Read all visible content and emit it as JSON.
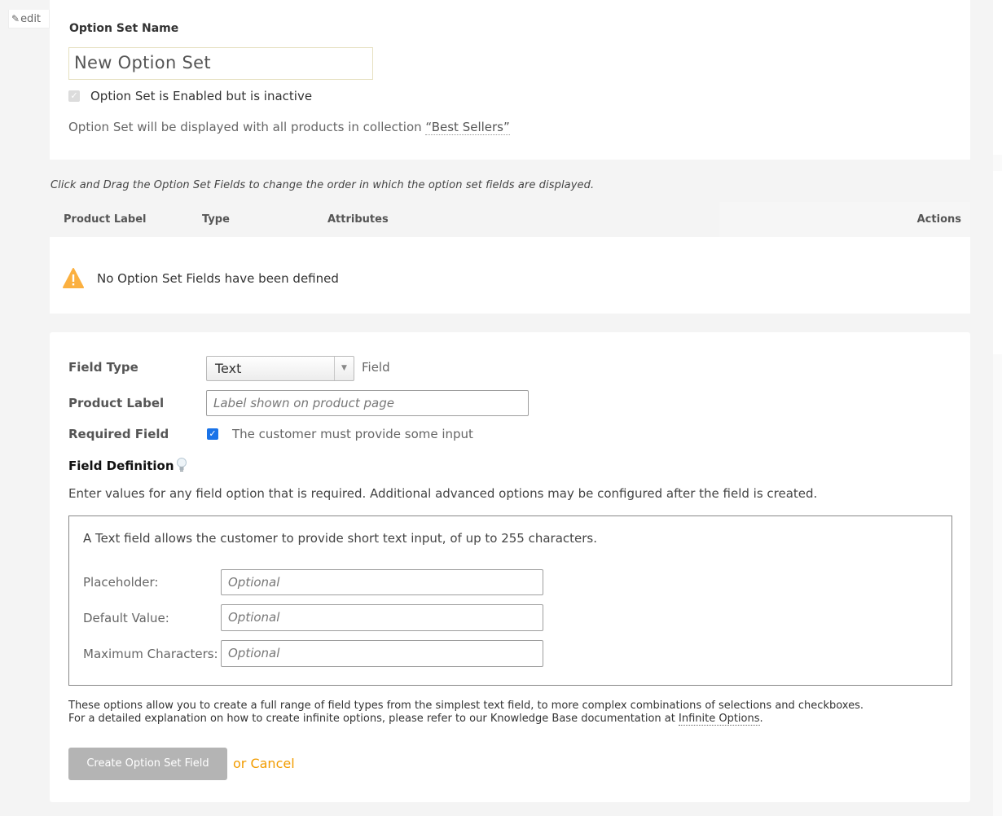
{
  "edit": {
    "label": "edit",
    "icon": "pencil-icon"
  },
  "option_set": {
    "name_label": "Option Set Name",
    "name_value": "New Option Set",
    "enabled_label": "Option Set is Enabled but is inactive",
    "display_info_prefix": "Option Set will be displayed with all products in collection ",
    "collection_name": "“Best Sellers”"
  },
  "fields_table": {
    "drag_hint": "Click and Drag the Option Set Fields to change the order in which the option set fields are displayed.",
    "columns": [
      "Product Label",
      "Type",
      "Attributes",
      "Actions"
    ],
    "empty_message": "No Option Set Fields have been defined",
    "warning_icon": "warning-icon"
  },
  "new_field_form": {
    "field_type_label": "Field Type",
    "field_type_value": "Text",
    "field_type_suffix": "Field",
    "product_label_label": "Product Label",
    "product_label_placeholder": "Label shown on product page",
    "required_label": "Required Field",
    "required_desc": "The customer must provide some input",
    "field_definition_title": "Field Definition",
    "field_definition_desc": "Enter values for any field option that is required. Additional advanced options may be configured after the field is created.",
    "definition_intro": "A Text field allows the customer to provide short text input, of up to 255 characters.",
    "placeholder_label": "Placeholder:",
    "default_value_label": "Default Value:",
    "max_chars_label": "Maximum Characters:",
    "optional_placeholder": "Optional",
    "help_line1": "These options allow you to create a full range of field types from the simplest text field, to more complex combinations of selections and checkboxes.",
    "help_line2_prefix": "For a detailed explanation on how to create infinite options, please refer to our Knowledge Base documentation at ",
    "help_link": "Infinite Options",
    "help_line2_suffix": ".",
    "create_button": "Create Option Set Field",
    "cancel_link": "or Cancel"
  },
  "colors": {
    "accent_orange": "#f29c00",
    "checkbox_blue": "#1a73e8",
    "warning_yellow": "#fbb040",
    "button_gray": "#b4b4b4"
  }
}
